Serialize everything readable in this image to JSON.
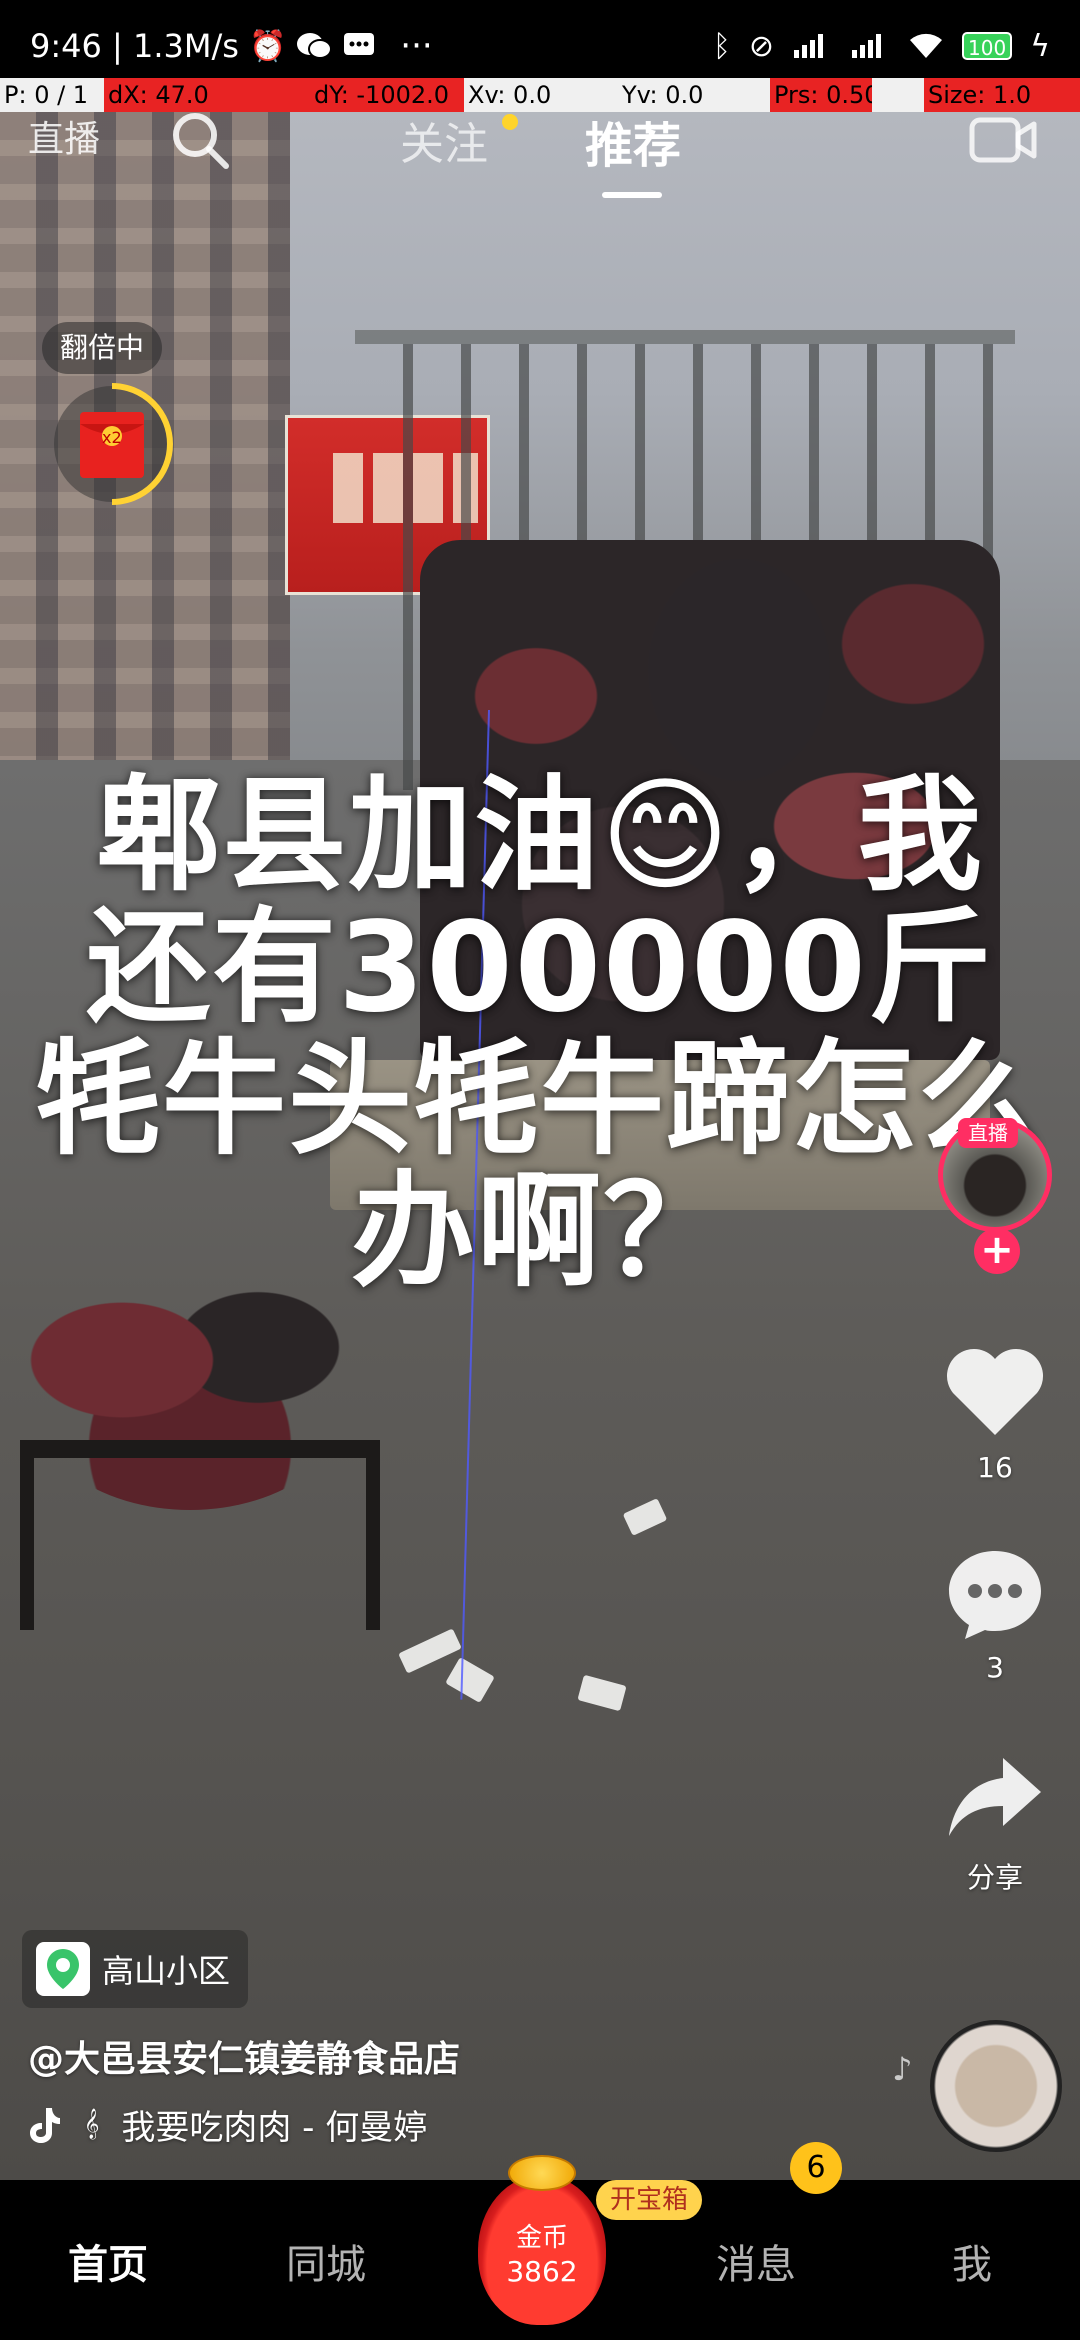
{
  "status_bar": {
    "time_speed": "9:46 | 1.3M/s",
    "more": "···",
    "battery": "100",
    "icons": [
      "alarm-icon",
      "wechat-icon",
      "sms-icon",
      "bluetooth-icon",
      "nfc-icon",
      "signal-icon",
      "signal-icon",
      "wifi-icon",
      "battery-icon",
      "charging-icon"
    ]
  },
  "debug_overlay": {
    "p": "P: 0 / 1",
    "dx": "dX: 47.0",
    "dy": "dY: -1002.0",
    "xv": "Xv: 0.0",
    "yv": "Yv: 0.0",
    "prs": "Prs: 0.50",
    "size": "Size: 1.0"
  },
  "top_nav": {
    "live": "直播",
    "tab_follow": "关注",
    "tab_recommend": "推荐",
    "has_new_follow_dot": true
  },
  "doubling": {
    "label": "翻倍中",
    "multiplier": "x2"
  },
  "caption": {
    "line1": "郫县加油😊，我",
    "line2": "还有300000斤",
    "line3": "牦牛头牦牛蹄怎么",
    "line4": "办啊？"
  },
  "creator": {
    "live_badge": "直播",
    "follow_plus": "+"
  },
  "actions": {
    "likes": "16",
    "comments": "3",
    "share_label": "分享"
  },
  "location": {
    "name": "高山小区"
  },
  "author": "@大邑县安仁镇姜静食品店",
  "music": {
    "title": "我要吃肉肉 - 何曼婷"
  },
  "tabbar": {
    "home": "首页",
    "nearby": "同城",
    "coin_label": "金币",
    "coin_value": "3862",
    "treasure": "开宝箱",
    "messages": "消息",
    "message_badge": "6",
    "me": "我"
  },
  "colors": {
    "accent_pink": "#ff2e63",
    "badge_yellow": "#ffc21a",
    "debug_red": "#e82323",
    "location_green": "#39c46a"
  }
}
